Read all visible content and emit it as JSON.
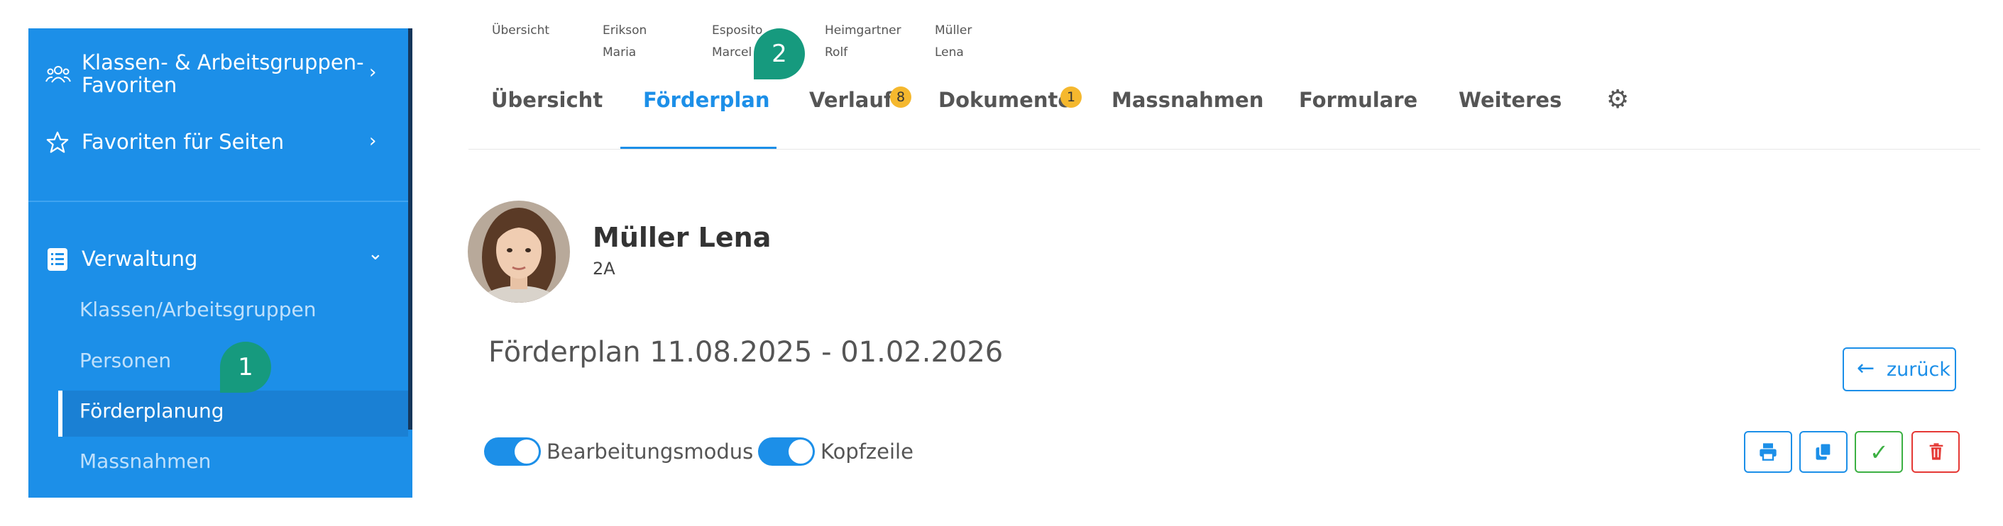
{
  "sidebar": {
    "items": [
      {
        "label": "Klassen- & Arbeitsgruppen-Favoriten",
        "line1": "Klassen- & Arbeitsgruppen-",
        "line2": "Favoriten",
        "icon": "users-icon",
        "chevron": "›"
      },
      {
        "label": "Favoriten für Seiten",
        "icon": "star-icon",
        "chevron": "›"
      },
      {
        "label": "Verwaltung",
        "icon": "list-icon",
        "chevron": "⌄"
      }
    ],
    "subitems": [
      {
        "label": "Klassen/Arbeitsgruppen"
      },
      {
        "label": "Personen"
      },
      {
        "label": "Förderplanung",
        "active": true
      },
      {
        "label": "Massnahmen"
      }
    ]
  },
  "students": [
    {
      "line1": "Übersicht",
      "line2": ""
    },
    {
      "line1": "Erikson",
      "line2": "Maria"
    },
    {
      "line1": "Esposito",
      "line2": "Marcel"
    },
    {
      "line1": "Heimgartner",
      "line2": "Rolf"
    },
    {
      "line1": "Müller",
      "line2": "Lena"
    }
  ],
  "tabs": [
    {
      "label": "Übersicht"
    },
    {
      "label": "Förderplan",
      "active": true
    },
    {
      "label": "Verlauf",
      "badge": "8"
    },
    {
      "label": "Dokumente",
      "badge": "1"
    },
    {
      "label": "Massnahmen"
    },
    {
      "label": "Formulare"
    },
    {
      "label": "Weiteres"
    }
  ],
  "markers": {
    "one": "1",
    "two": "2"
  },
  "profile": {
    "name": "Müller Lena",
    "class": "2A"
  },
  "plan": {
    "title": "Förderplan 11.08.2025 - 01.02.2026"
  },
  "back_button": {
    "label": "zurück"
  },
  "toggles": {
    "edit_label": "Bearbeitungsmodus",
    "edit_on": true,
    "header_label": "Kopfzeile",
    "header_on": true
  },
  "colors": {
    "primary": "#1c8fe8",
    "sidebar": "#1c8fe8",
    "marker": "#169a7e",
    "badge": "#f5b82e",
    "success": "#3cb043",
    "danger": "#e53935"
  },
  "icons": {
    "settings": "gear-icon",
    "print": "print-icon",
    "copy": "copy-icon",
    "confirm": "check-icon",
    "delete": "trash-icon"
  }
}
